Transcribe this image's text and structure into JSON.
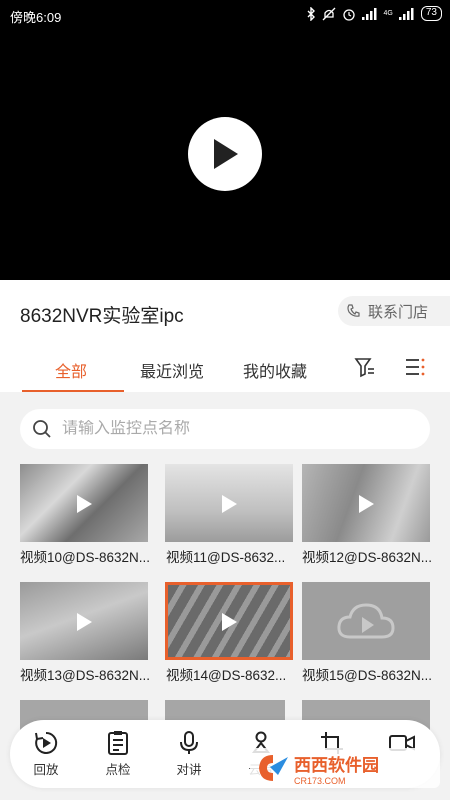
{
  "status": {
    "time": "傍晚6:09",
    "network": "4G",
    "battery": "73"
  },
  "camera_title": "8632NVR实验室ipc",
  "contact_button": "联系门店",
  "tabs": [
    {
      "label": "全部"
    },
    {
      "label": "最近浏览"
    },
    {
      "label": "我的收藏"
    }
  ],
  "search": {
    "placeholder": "请输入监控点名称"
  },
  "videos": [
    {
      "caption": "视频10@DS-8632N..."
    },
    {
      "caption": "视频11@DS-8632..."
    },
    {
      "caption": "视频12@DS-8632N..."
    },
    {
      "caption": "视频13@DS-8632N..."
    },
    {
      "caption": "视频14@DS-8632..."
    },
    {
      "caption": "视频15@DS-8632N..."
    }
  ],
  "bottom_nav": [
    {
      "label": "回放",
      "icon": "playback-icon"
    },
    {
      "label": "点检",
      "icon": "checklist-icon"
    },
    {
      "label": "对讲",
      "icon": "microphone-icon"
    },
    {
      "label": "云台",
      "icon": "ptz-icon"
    },
    {
      "label": "",
      "icon": "crop-icon"
    },
    {
      "label": "",
      "icon": "record-video-icon"
    }
  ],
  "watermark": {
    "main": "西西软件园",
    "sub": "CR173.COM"
  },
  "accent_color": "#e8602c"
}
